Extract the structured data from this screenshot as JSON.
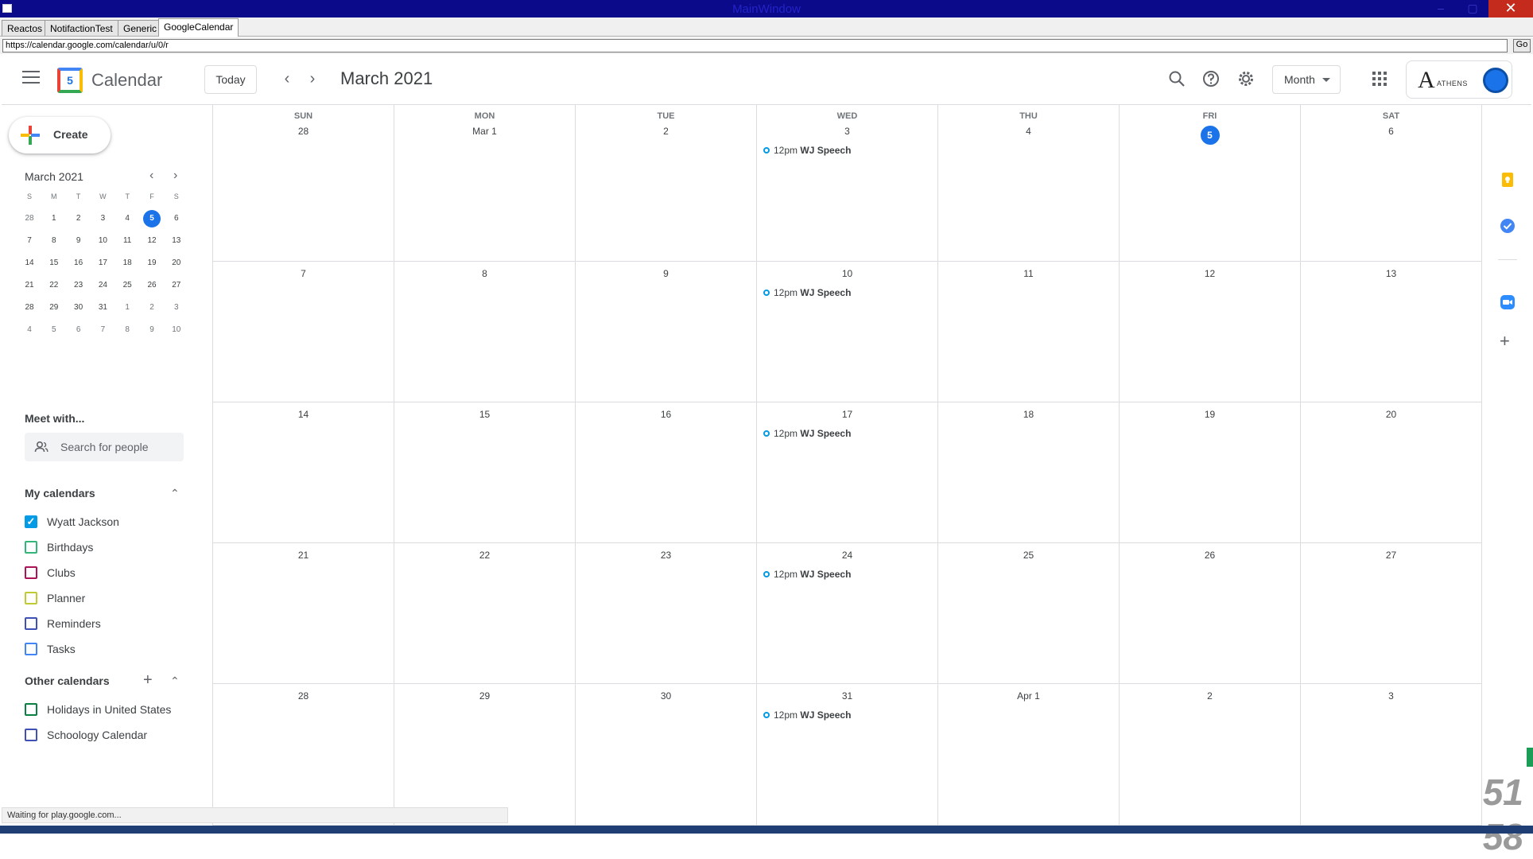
{
  "window": {
    "title": "MainWindow",
    "close": "✕",
    "min": "–",
    "max": "▢"
  },
  "tabs": [
    "Reactos",
    "NotifactionTest",
    "Generic",
    "GoogleCalendar"
  ],
  "address": {
    "url": "https://calendar.google.com/calendar/u/0/r",
    "go": "Go"
  },
  "header": {
    "app_name": "Calendar",
    "logo_day": "5",
    "today": "Today",
    "prev": "‹",
    "next": "›",
    "title": "March 2021",
    "view": "Month",
    "brand_letter": "A",
    "brand_name": "ATHENS"
  },
  "sidebar": {
    "create": "Create",
    "mini_title": "March 2021",
    "mini_prev": "‹",
    "mini_next": "›",
    "dow": [
      "S",
      "M",
      "T",
      "W",
      "T",
      "F",
      "S"
    ],
    "mini_weeks": [
      [
        "28",
        "1",
        "2",
        "3",
        "4",
        "5",
        "6"
      ],
      [
        "7",
        "8",
        "9",
        "10",
        "11",
        "12",
        "13"
      ],
      [
        "14",
        "15",
        "16",
        "17",
        "18",
        "19",
        "20"
      ],
      [
        "21",
        "22",
        "23",
        "24",
        "25",
        "26",
        "27"
      ],
      [
        "28",
        "29",
        "30",
        "31",
        "1",
        "2",
        "3"
      ],
      [
        "4",
        "5",
        "6",
        "7",
        "8",
        "9",
        "10"
      ]
    ],
    "meet_with": "Meet with...",
    "search_people": "Search for people",
    "my_calendars": "My calendars",
    "my_items": [
      {
        "name": "Wyatt Jackson",
        "color": "#039be5",
        "checked": true
      },
      {
        "name": "Birthdays",
        "color": "#33b679",
        "checked": false
      },
      {
        "name": "Clubs",
        "color": "#ad1457",
        "checked": false
      },
      {
        "name": "Planner",
        "color": "#c0ca33",
        "checked": false
      },
      {
        "name": "Reminders",
        "color": "#3f51b5",
        "checked": false
      },
      {
        "name": "Tasks",
        "color": "#4285f4",
        "checked": false
      }
    ],
    "other_calendars": "Other calendars",
    "other_items": [
      {
        "name": "Holidays in United States",
        "color": "#0b8043",
        "checked": false
      },
      {
        "name": "Schoology Calendar",
        "color": "#3f51b5",
        "checked": false
      }
    ],
    "collapse": "⌃",
    "add": "+"
  },
  "calendar": {
    "dow": [
      "SUN",
      "MON",
      "TUE",
      "WED",
      "THU",
      "FRI",
      "SAT"
    ],
    "weeks": [
      [
        "28",
        "Mar 1",
        "2",
        "3",
        "4",
        "5",
        "6"
      ],
      [
        "7",
        "8",
        "9",
        "10",
        "11",
        "12",
        "13"
      ],
      [
        "14",
        "15",
        "16",
        "17",
        "18",
        "19",
        "20"
      ],
      [
        "21",
        "22",
        "23",
        "24",
        "25",
        "26",
        "27"
      ],
      [
        "28",
        "29",
        "30",
        "31",
        "Apr 1",
        "2",
        "3"
      ]
    ],
    "today": "5",
    "event": {
      "time": "12pm",
      "title": "WJ Speech",
      "weekday_col": 3
    }
  },
  "overlay": {
    "num1": "51",
    "num2": "58"
  },
  "status": "Waiting for play.google.com...",
  "right_rail": {
    "add": "+",
    "expand": "›"
  }
}
